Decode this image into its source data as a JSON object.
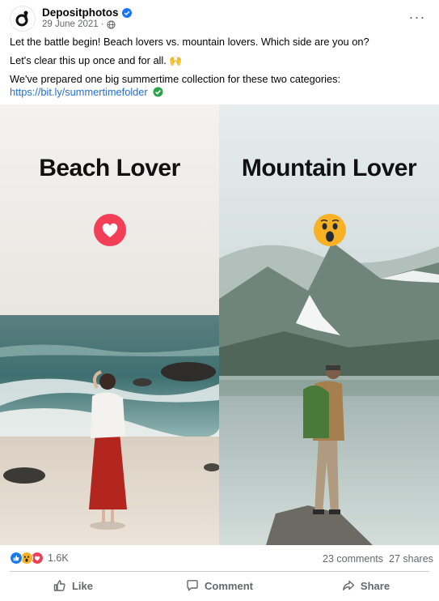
{
  "post": {
    "author": "Depositphotos",
    "date": "29 June 2021",
    "separator": "·",
    "more_label": "···",
    "lines": [
      "Let the battle begin! Beach lovers vs. mountain lovers. Which side are you on?",
      "Let's clear this up once and for all. 🙌",
      "We've prepared one big summertime collection for these two categories:"
    ],
    "link": "https://bit.ly/summertimefolder"
  },
  "media": {
    "left_title": "Beach Lover",
    "right_title": "Mountain Lover",
    "left_reaction": "love-reaction-icon",
    "right_reaction": "wow-reaction-icon"
  },
  "stats": {
    "reaction_count": "1.6K",
    "comments": "23 comments",
    "shares": "27 shares"
  },
  "actions": {
    "like": "Like",
    "comment": "Comment",
    "share": "Share"
  },
  "colors": {
    "brand_blue": "#1877f2",
    "link": "#216fdb",
    "love": "#f33e58",
    "wow": "#f7b125",
    "muted": "#65676b"
  }
}
